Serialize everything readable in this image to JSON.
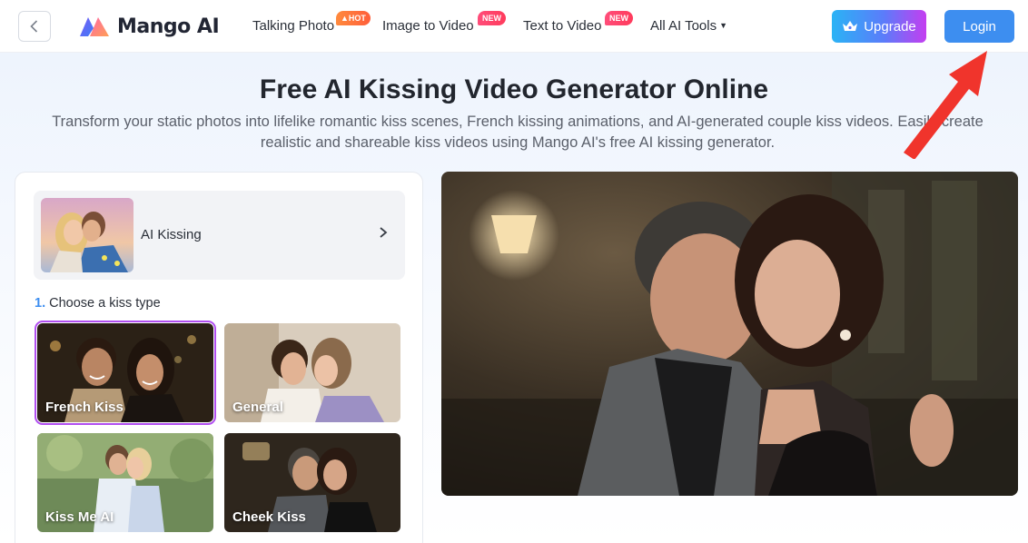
{
  "header": {
    "logo_text": "Mango AI",
    "nav": [
      {
        "label": "Talking Photo",
        "badge": "HOT"
      },
      {
        "label": "Image to Video",
        "badge": "NEW"
      },
      {
        "label": "Text to Video",
        "badge": "NEW"
      },
      {
        "label": "All AI Tools",
        "badge": ""
      }
    ],
    "upgrade_label": "Upgrade",
    "login_label": "Login"
  },
  "hero": {
    "title": "Free AI Kissing Video Generator Online",
    "subtitle": "Transform your static photos into lifelike romantic kiss scenes, French kissing animations, and AI-generated couple kiss videos. Easily create realistic and shareable kiss videos using Mango AI's free AI kissing generator."
  },
  "panel": {
    "model_label": "AI Kissing",
    "step_number": "1.",
    "step_label": "Choose a kiss type",
    "kiss_types": [
      {
        "label": "French Kiss",
        "selected": true
      },
      {
        "label": "General",
        "selected": false
      },
      {
        "label": "Kiss Me AI",
        "selected": false
      },
      {
        "label": "Cheek Kiss",
        "selected": false
      }
    ]
  },
  "colors": {
    "accent": "#3d8ef0",
    "selected_outline": "#b14ef0",
    "arrow": "#f0342c"
  }
}
